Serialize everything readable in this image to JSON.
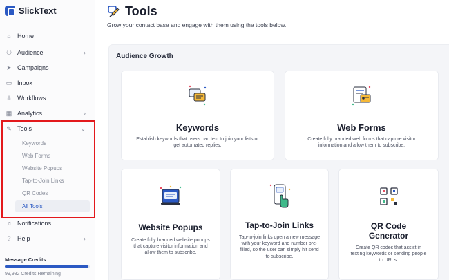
{
  "brand": {
    "name": "SlickText"
  },
  "sidebar": {
    "items": [
      {
        "label": "Home",
        "icon": "home-icon",
        "glyph": "⌂",
        "has_chevron": false
      },
      {
        "label": "Audience",
        "icon": "audience-icon",
        "glyph": "⚇",
        "has_chevron": true
      },
      {
        "label": "Campaigns",
        "icon": "campaigns-icon",
        "glyph": "➤",
        "has_chevron": false
      },
      {
        "label": "Inbox",
        "icon": "inbox-icon",
        "glyph": "▭",
        "has_chevron": false
      },
      {
        "label": "Workflows",
        "icon": "workflows-icon",
        "glyph": "⋔",
        "has_chevron": false
      },
      {
        "label": "Analytics",
        "icon": "analytics-icon",
        "glyph": "▦",
        "has_chevron": true
      },
      {
        "label": "Tools",
        "icon": "tools-icon",
        "glyph": "✎",
        "has_chevron": true,
        "expanded": true
      }
    ],
    "tools_sub": [
      {
        "label": "Keywords"
      },
      {
        "label": "Web Forms"
      },
      {
        "label": "Website Popups"
      },
      {
        "label": "Tap-to-Join Links"
      },
      {
        "label": "QR Codes"
      },
      {
        "label": "All Tools",
        "active": true
      }
    ],
    "bottom_items": [
      {
        "label": "Notifications",
        "icon": "bell-icon",
        "glyph": "♫"
      },
      {
        "label": "Help",
        "icon": "help-icon",
        "glyph": "?",
        "has_chevron": true
      }
    ],
    "credits": {
      "title": "Message Credits",
      "remaining": "99,982 Credits Remaining"
    }
  },
  "main": {
    "title": "Tools",
    "subtitle": "Grow your contact base and engage with them using the tools below.",
    "section": "Audience Growth",
    "cards": [
      {
        "title": "Keywords",
        "desc": "Establish keywords that users can text to join your lists or get automated replies.",
        "icon": "keywords-icon"
      },
      {
        "title": "Web Forms",
        "desc": "Create fully branded web forms that capture visitor information and allow them to subscribe.",
        "icon": "web-forms-icon"
      },
      {
        "title": "Website Popups",
        "desc": "Create fully branded website popups that capture visitor information and allow them to subscribe.",
        "icon": "website-popups-icon"
      },
      {
        "title": "Tap-to-Join Links",
        "desc": "Tap-to-join links open a new message with your keyword and number pre-filled, so the user can simply hit send to subscribe.",
        "icon": "tap-to-join-icon"
      },
      {
        "title": "QR Code Generator",
        "desc": "Create QR codes that assist in texting keywords or sending people to URLs.",
        "icon": "qr-code-icon"
      }
    ]
  },
  "colors": {
    "accent": "#2b59c3",
    "highlight_box": "#e3191c",
    "panel_bg": "#f4f5f8"
  }
}
